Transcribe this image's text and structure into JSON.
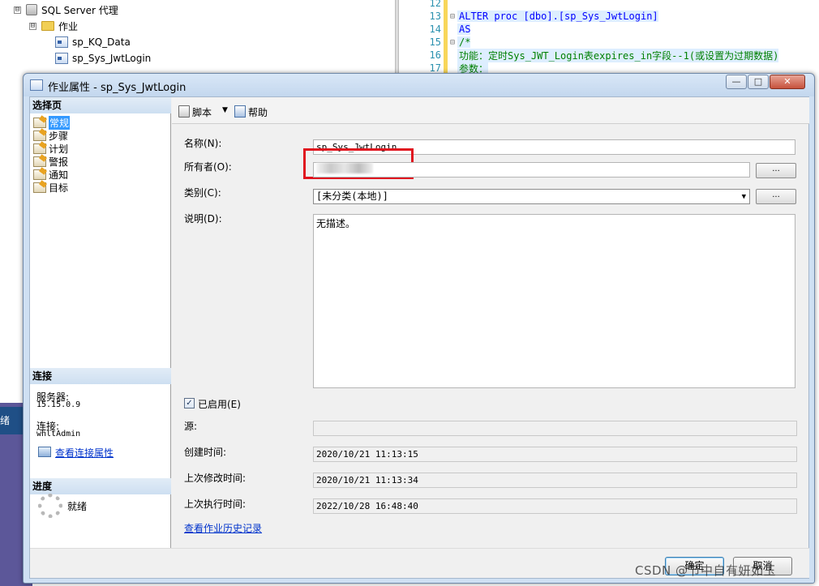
{
  "background": {
    "tree": [
      {
        "toggle": "⊟",
        "label": "SQL Server 代理",
        "icon": "agent-icon"
      },
      {
        "toggle": "⊟",
        "label": "作业",
        "icon": "folder-icon"
      },
      {
        "label": "sp_KQ_Data",
        "icon": "job-icon"
      },
      {
        "label": "sp_Sys_JwtLogin",
        "icon": "job-icon"
      }
    ],
    "code_lines": [
      {
        "num": "12",
        "text": ""
      },
      {
        "num": "13",
        "fold": "⊟",
        "text": "ALTER proc [dbo].[sp_Sys_JwtLogin]"
      },
      {
        "num": "14",
        "text": "AS"
      },
      {
        "num": "15",
        "fold": "⊟",
        "text": "/*"
      },
      {
        "num": "16",
        "text": "功能：定时Sys_JWT_Login表expires_in字段--1(或设置为过期数据)"
      },
      {
        "num": "17",
        "text": "参数："
      }
    ],
    "status_text": "绪"
  },
  "dialog": {
    "title": "作业属性 - sp_Sys_JwtLogin",
    "window_buttons": {
      "minimize": "—",
      "maximize": "□",
      "close": "✕"
    },
    "left": {
      "select_page_header": "选择页",
      "pages": [
        "常规",
        "步骤",
        "计划",
        "警报",
        "通知",
        "目标"
      ],
      "selected_page": "常规",
      "connection_header": "连接",
      "server_label": "服务器:",
      "server_value": "15.15.0.9",
      "connection_label": "连接:",
      "connection_value": "whltAdmin",
      "view_connection_link": "查看连接属性",
      "progress_header": "进度",
      "progress_status": "就绪"
    },
    "toolbar": {
      "script_label": "脚本",
      "script_arrow": "▼",
      "help_label": "帮助"
    },
    "form": {
      "name_label": "名称(N):",
      "name_value": "sp_Sys_JwtLogin",
      "owner_label": "所有者(O):",
      "category_label": "类别(C):",
      "category_value": "[未分类(本地)]",
      "description_label": "说明(D):",
      "description_value": "无描述。",
      "enabled_label": "已启用(E)",
      "enabled_check": "✓",
      "source_label": "源:",
      "created_label": "创建时间:",
      "created_value": "2020/10/21 11:13:15",
      "modified_label": "上次修改时间:",
      "modified_value": "2020/10/21 11:13:34",
      "executed_label": "上次执行时间:",
      "executed_value": "2022/10/28 16:48:40",
      "history_link": "查看作业历史记录",
      "ellipsis": "..."
    },
    "buttons": {
      "ok": "确定",
      "cancel": "取消"
    }
  },
  "watermark": "CSDN @节中自有妍如玉"
}
